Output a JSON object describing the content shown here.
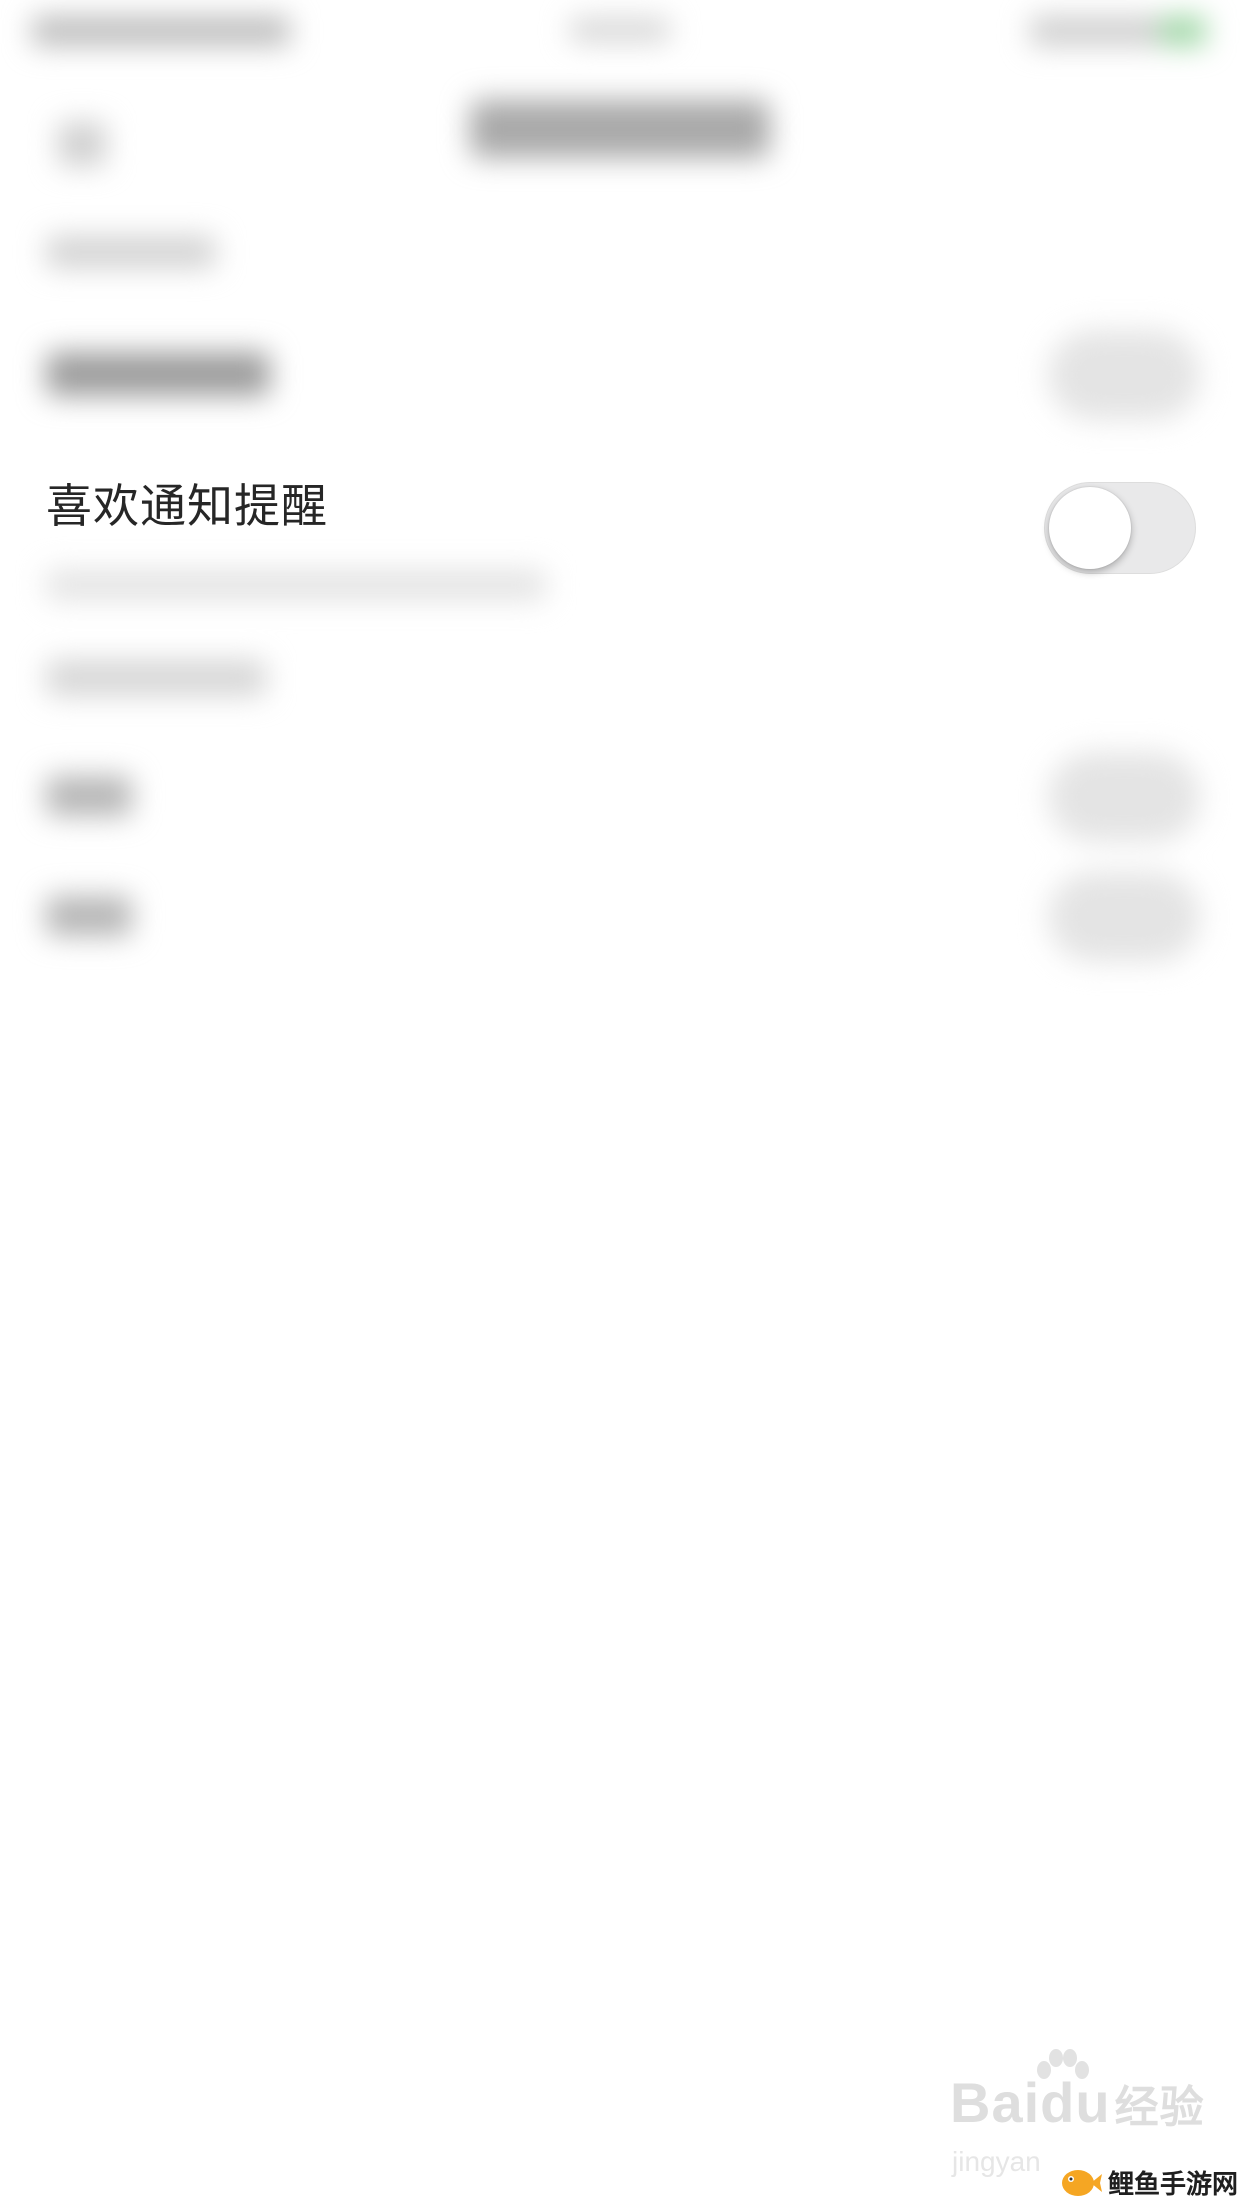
{
  "settings": {
    "reminder_row": {
      "label": "喜欢通知提醒",
      "toggle_on": false
    }
  },
  "watermark": {
    "baidu_text": "Bai",
    "du_text": "du",
    "jingyan_cn": "经验",
    "jingyan_en": "jingyan"
  },
  "brand": {
    "name": "鲤鱼手游网",
    "accent_color": "#f5a623"
  }
}
